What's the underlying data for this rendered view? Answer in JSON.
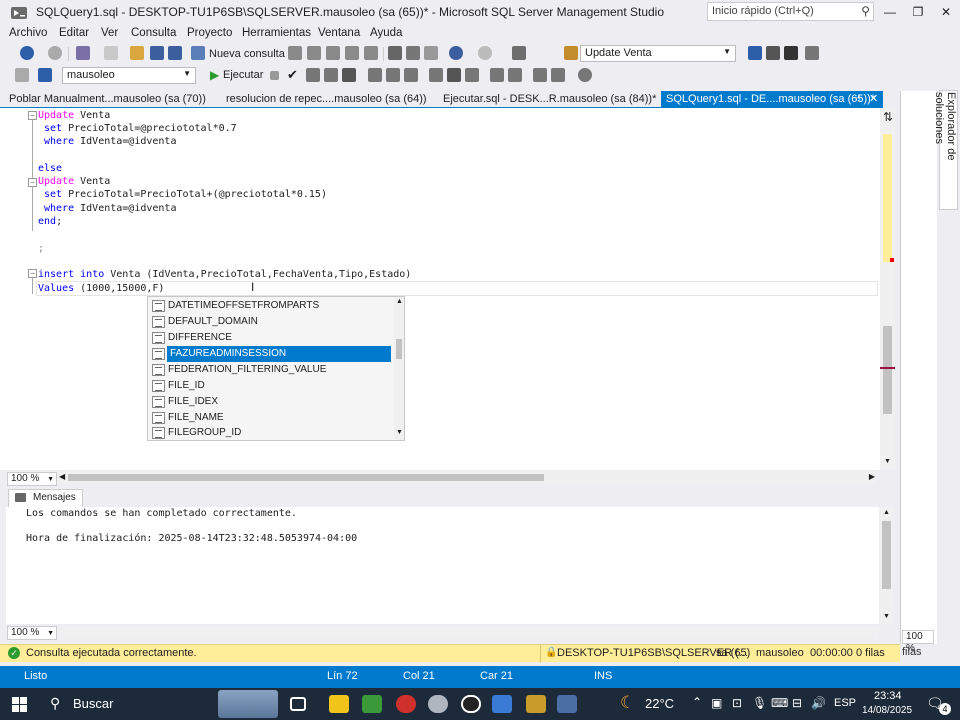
{
  "title_bar": {
    "title": "SQLQuery1.sql - DESKTOP-TU1P6SB\\SQLSERVER.mausoleo (sa (65))* - Microsoft SQL Server Management Studio",
    "quick_launch_placeholder": "Inicio rápido (Ctrl+Q)",
    "minimize": "—",
    "maximize": "❐",
    "close": "✕"
  },
  "menu": [
    "Archivo",
    "Editar",
    "Ver",
    "Consulta",
    "Proyecto",
    "Herramientas",
    "Ventana",
    "Ayuda"
  ],
  "toolbar1": {
    "new_query_label": "Nueva consulta",
    "object_combo": "Update Venta"
  },
  "toolbar2": {
    "database": "mausoleo",
    "execute_label": "Ejecutar"
  },
  "doc_tabs": [
    {
      "label": "Poblar Manualment...mausoleo (sa (70))",
      "active": false
    },
    {
      "label": "resolucion de repec....mausoleo (sa (64))",
      "active": false
    },
    {
      "label": "Ejecutar.sql - DESK...R.mausoleo (sa (84))*",
      "active": false
    },
    {
      "label": "SQLQuery1.sql - DE....mausoleo (sa (65))*",
      "active": true
    }
  ],
  "code": {
    "l1_kw": "Update",
    "l1_rest": " Venta",
    "l2_kw": "set",
    "l2_rest": " PrecioTotal=@preciototal*0.7",
    "l3_kw": "where",
    "l3_rest": " IdVenta=@idventa",
    "l5_kw": "else",
    "l6_kw": "Update",
    "l6_rest": " Venta",
    "l7_kw": "set",
    "l7_rest": " PrecioTotal=PrecioTotal+(@preciototal*0.15)",
    "l8_kw": "where",
    "l8_rest": " IdVenta=@idventa",
    "l9_kw": "end",
    "l9_rest": ";",
    "l11": ";",
    "l13_kw1": "insert",
    "l13_kw2": "into",
    "l13_rest": " Venta (IdVenta,PrecioTotal,FechaVenta,Tipo,Estado)",
    "l14_kw": "Values",
    "l14_rest": " (1000,15000,F)"
  },
  "completion": [
    "DATETIMEOFFSETFROMPARTS",
    "DEFAULT_DOMAIN",
    "DIFFERENCE",
    "FAZUREADMINSESSION",
    "FEDERATION_FILTERING_VALUE",
    "FILE_ID",
    "FILE_IDEX",
    "FILE_NAME",
    "FILEGROUP_ID"
  ],
  "completion_selected_index": 3,
  "editor_zoom": "100 %",
  "messages": {
    "tab_label": "Mensajes",
    "line1": "Los comandos se han completado correctamente.",
    "line2": "Hora de finalización: 2025-08-14T23:32:48.5053974-04:00",
    "zoom": "100 %"
  },
  "right_panel": {
    "solution_explorer": "Explorador de soluciones",
    "zoom": "100 %",
    "files_label": "filas"
  },
  "query_status": {
    "message": "Consulta ejecutada correctamente.",
    "server": "DESKTOP-TU1P6SB\\SQLSERVER (...",
    "user": "sa (65)",
    "db": "mausoleo",
    "time": "00:00:00",
    "rows": "0 filas"
  },
  "ide_status": {
    "ready": "Listo",
    "line": "Lín 72",
    "col": "Col 21",
    "char": "Car 21",
    "mode": "INS"
  },
  "taskbar": {
    "search": "Buscar",
    "weather": "22°C",
    "lang": "ESP",
    "time": "23:34",
    "date": "14/08/2025",
    "notif": "4"
  },
  "colors": {
    "accent": "#007acc",
    "keyword": "#0000ff",
    "keyword_pink": "#ff00ff",
    "status_yellow": "#ffee99",
    "taskbar": "#1d2a3a"
  }
}
